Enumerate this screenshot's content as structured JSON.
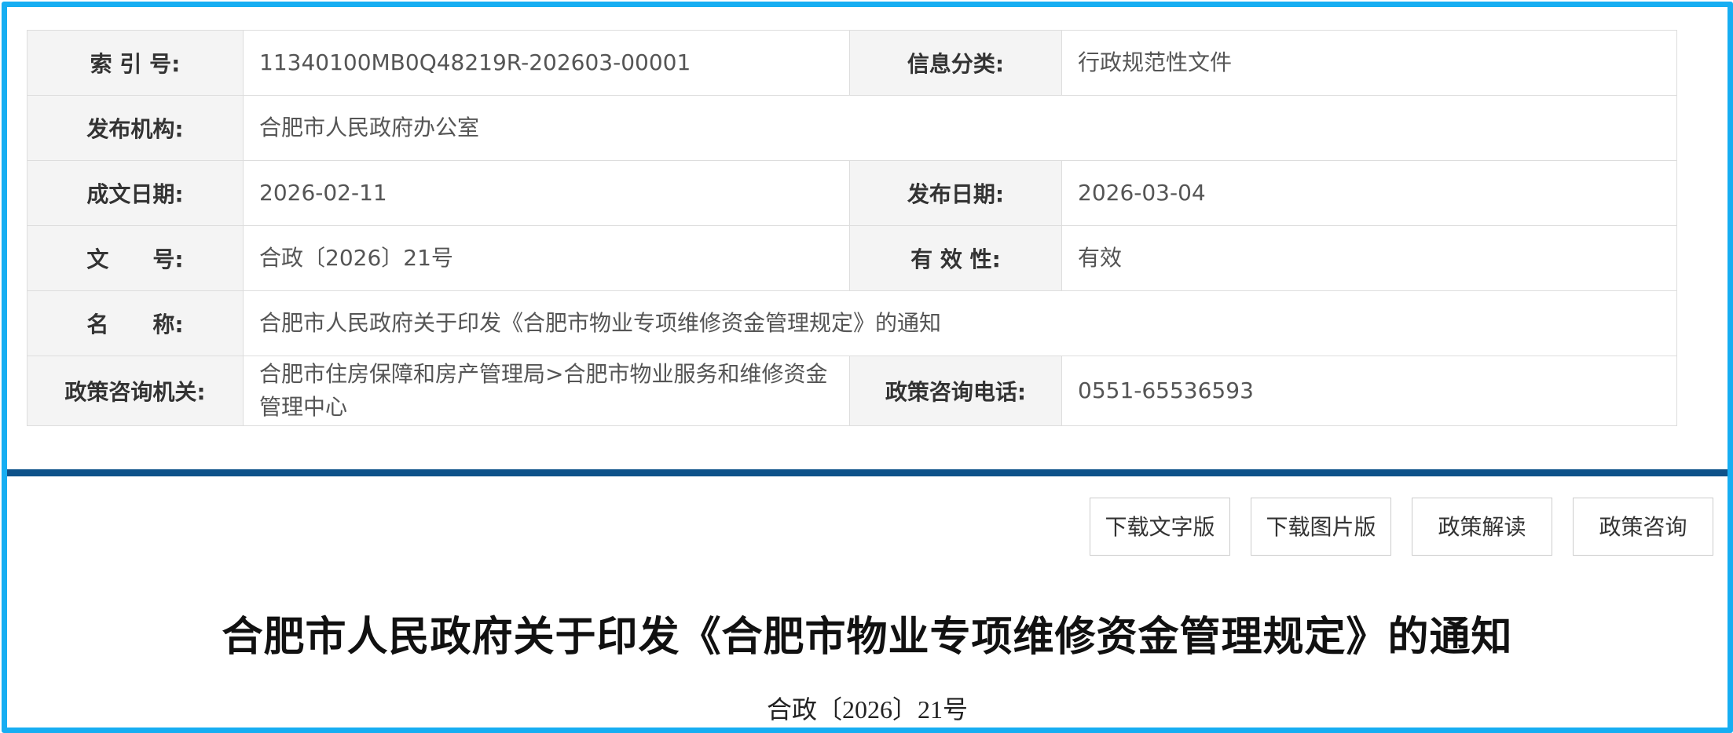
{
  "meta": {
    "index_no_label": "索 引 号:",
    "index_no_value": "11340100MB0Q48219R-202603-00001",
    "category_label": "信息分类:",
    "category_value": "行政规范性文件",
    "publisher_label": "发布机构:",
    "publisher_value": "合肥市人民政府办公室",
    "written_date_label": "成文日期:",
    "written_date_value": "2026-02-11",
    "publish_date_label": "发布日期:",
    "publish_date_value": "2026-03-04",
    "doc_no_label": "文　　号:",
    "doc_no_value": "合政〔2026〕21号",
    "validity_label": "有 效 性:",
    "validity_value": "有效",
    "name_label": "名　　称:",
    "name_value": "合肥市人民政府关于印发《合肥市物业专项维修资金管理规定》的通知",
    "consult_org_label": "政策咨询机关:",
    "consult_org_value": "合肥市住房保障和房产管理局>合肥市物业服务和维修资金管理中心",
    "consult_phone_label": "政策咨询电话:",
    "consult_phone_value": "0551-65536593"
  },
  "actions": {
    "download_text": "下载文字版",
    "download_image": "下载图片版",
    "policy_interpretation": "政策解读",
    "policy_consult": "政策咨询"
  },
  "document": {
    "title": "合肥市人民政府关于印发《合肥市物业专项维修资金管理规定》的通知",
    "doc_no": "合政〔2026〕21号"
  },
  "colors": {
    "frame_border": "#17aef2",
    "divider": "#0d528a",
    "label_bg": "#f4f4f4"
  }
}
